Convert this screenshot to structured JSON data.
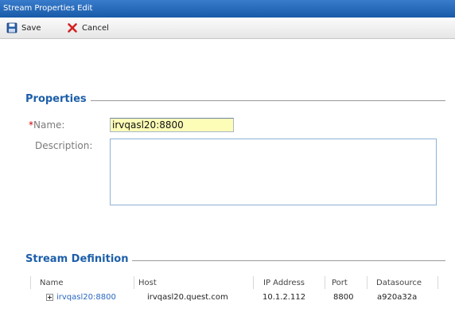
{
  "window": {
    "title": "Stream Properties Edit"
  },
  "toolbar": {
    "save_label": "Save",
    "cancel_label": "Cancel",
    "save_icon": "floppy-disk-icon",
    "cancel_icon": "red-x-icon"
  },
  "properties": {
    "section_title": "Properties",
    "name_required_marker": "*",
    "name_label": "Name:",
    "name_value": "irvqasl20:8800",
    "description_label": "Description:",
    "description_value": ""
  },
  "stream_definition": {
    "section_title": "Stream Definition",
    "columns": [
      "Name",
      "Host",
      "IP Address",
      "Port",
      "Datasource"
    ],
    "rows": [
      {
        "name": "irvqasl20:8800",
        "host": "irvqasl20.quest.com",
        "ip": "10.1.2.112",
        "port": "8800",
        "datasource": "a920a32a"
      }
    ]
  },
  "colors": {
    "title_bar": "#175aa8",
    "section_title": "#1d5fa9",
    "required": "#d00000",
    "name_field_bg": "#fdfdb8",
    "link": "#2a67c2"
  }
}
